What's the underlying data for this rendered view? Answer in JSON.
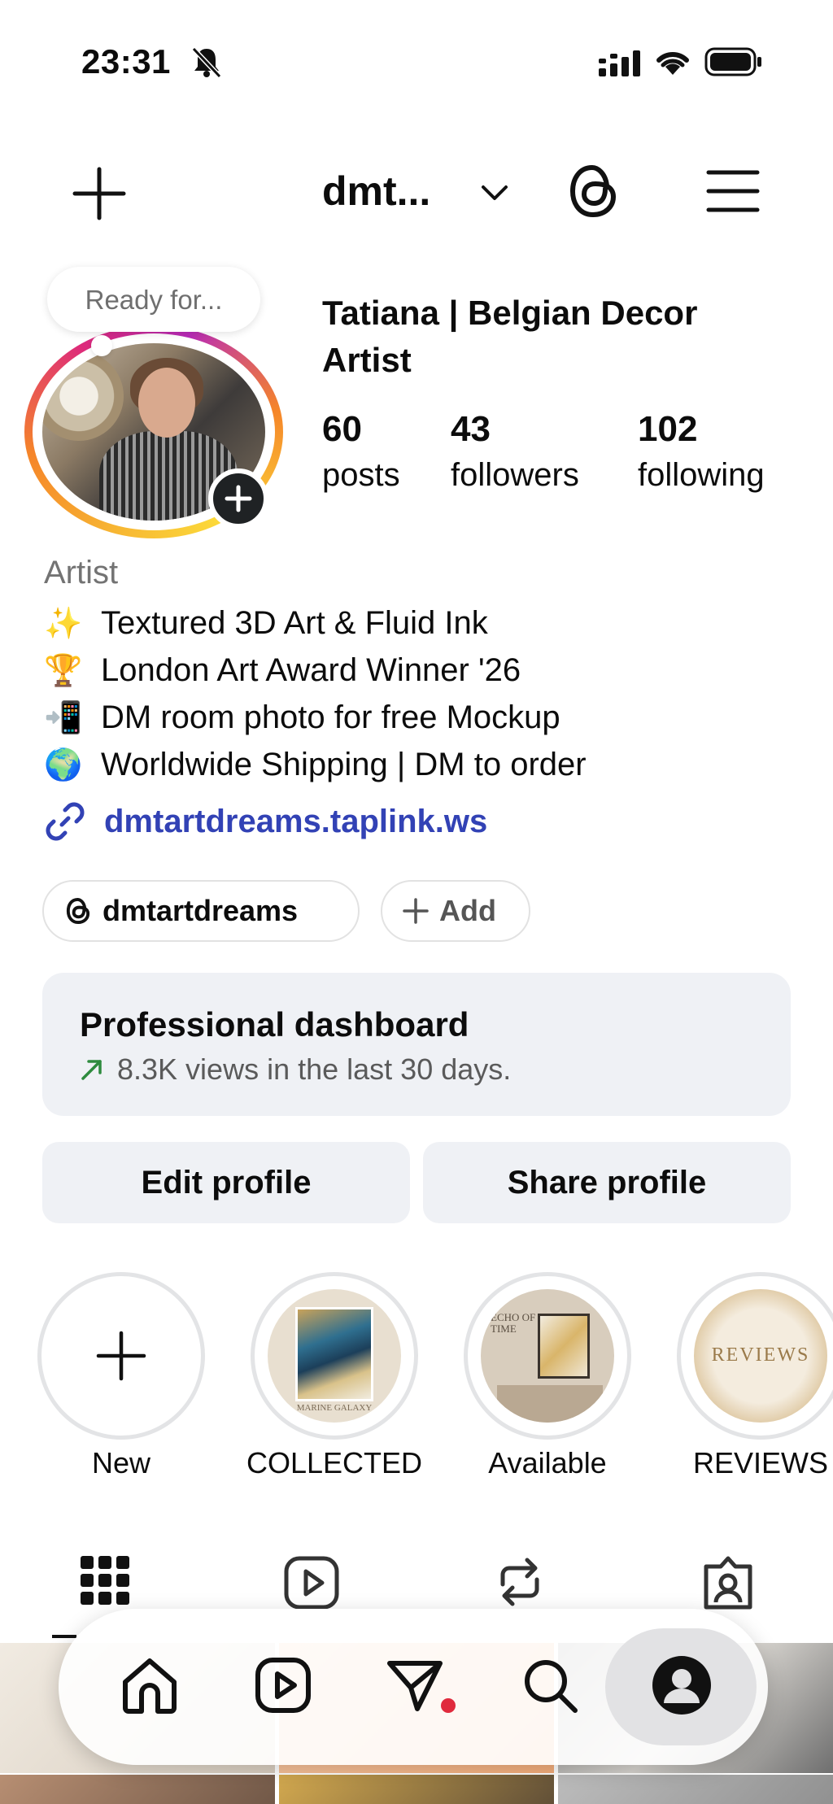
{
  "status_bar": {
    "time": "23:31",
    "icons": [
      "bell-off-icon",
      "signal-icon",
      "wifi-icon",
      "battery-icon"
    ]
  },
  "nav": {
    "username": "dmt...",
    "icons": [
      "plus-icon",
      "chevron-down-icon",
      "threads-icon",
      "menu-icon"
    ]
  },
  "note": {
    "text": "Ready for..."
  },
  "profile": {
    "display_name": "Tatiana | Belgian Decor Artist",
    "stats": [
      {
        "value": "60",
        "label": "posts"
      },
      {
        "value": "43",
        "label": "followers"
      },
      {
        "value": "102",
        "label": "following"
      }
    ]
  },
  "bio": {
    "category": "Artist",
    "lines": [
      {
        "emoji": "✨",
        "text": "Textured 3D Art & Fluid Ink"
      },
      {
        "emoji": "🏆",
        "text": "London Art Award Winner '26"
      },
      {
        "emoji": "📲",
        "text": "DM room photo for free Mockup"
      },
      {
        "emoji": "🌍",
        "text": "Worldwide Shipping | DM to order"
      }
    ],
    "link": "dmtartdreams.taplink.ws"
  },
  "chips": {
    "threads_handle": "dmtartdreams",
    "add_label": "Add"
  },
  "dashboard": {
    "title": "Professional dashboard",
    "subtitle": "8.3K views in the last 30 days."
  },
  "buttons": {
    "edit": "Edit profile",
    "share": "Share profile"
  },
  "highlights": [
    {
      "label": "New"
    },
    {
      "label": "COLLECTED",
      "image_text": "MARINE GALAXY"
    },
    {
      "label": "Available",
      "image_text": "ECHO OF TIME"
    },
    {
      "label": "REVIEWS",
      "image_text": "REVIEWS"
    }
  ],
  "tabs": [
    "grid-icon",
    "reels-icon",
    "reposts-icon",
    "tagged-icon"
  ],
  "bottom_nav": [
    "home-icon",
    "reels-icon",
    "direct-icon",
    "search-icon",
    "profile-icon"
  ],
  "colors": {
    "accent_link": "#3242b5",
    "dashboard_bg": "#eff1f5",
    "trend_green": "#2e8b3e",
    "notification_red": "#e02a3d"
  }
}
